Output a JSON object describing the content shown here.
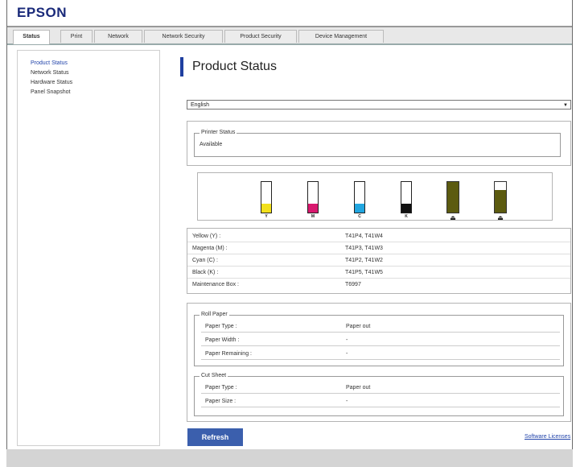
{
  "brand": {
    "logo": "EPSON"
  },
  "tabs": [
    {
      "label": "Status",
      "active": true
    },
    {
      "label": "Print"
    },
    {
      "label": "Network"
    },
    {
      "label": "Network Security"
    },
    {
      "label": "Product Security"
    },
    {
      "label": "Device Management"
    }
  ],
  "sidebar": {
    "items": [
      {
        "label": "Product Status",
        "active": true
      },
      {
        "label": "Network Status"
      },
      {
        "label": "Hardware Status"
      },
      {
        "label": "Panel Snapshot"
      }
    ]
  },
  "main": {
    "title": "Product Status",
    "language": {
      "selected": "English"
    },
    "printer_status": {
      "legend": "Printer Status",
      "value": "Available"
    },
    "inks": [
      {
        "label": "Y",
        "color": "#f2e01c",
        "level": 0.3
      },
      {
        "label": "M",
        "color": "#d8186e",
        "level": 0.3
      },
      {
        "label": "C",
        "color": "#21a6e0",
        "level": 0.3
      },
      {
        "label": "K",
        "color": "#111111",
        "level": 0.3
      }
    ],
    "maintenance_tanks": [
      {
        "icon": "maintenance-box-icon",
        "level": 1.0
      },
      {
        "icon": "maintenance-box-icon",
        "level": 0.75
      }
    ],
    "cartridges": [
      {
        "name": "Yellow (Y) :",
        "code": "T41P4, T41W4"
      },
      {
        "name": "Magenta (M) :",
        "code": "T41P3, T41W3"
      },
      {
        "name": "Cyan (C) :",
        "code": "T41P2, T41W2"
      },
      {
        "name": "Black (K) :",
        "code": "T41P5, T41W5"
      },
      {
        "name": "Maintenance Box :",
        "code": "T6997"
      }
    ],
    "roll_paper": {
      "legend": "Roll Paper",
      "rows": [
        {
          "k": "Paper Type :",
          "v": "Paper out"
        },
        {
          "k": "Paper Width :",
          "v": "-"
        },
        {
          "k": "Paper Remaining :",
          "v": "-"
        }
      ]
    },
    "cut_sheet": {
      "legend": "Cut Sheet",
      "rows": [
        {
          "k": "Paper Type :",
          "v": "Paper out"
        },
        {
          "k": "Paper Size :",
          "v": "-"
        }
      ]
    },
    "refresh_label": "Refresh",
    "license_label": "Software Licenses"
  }
}
